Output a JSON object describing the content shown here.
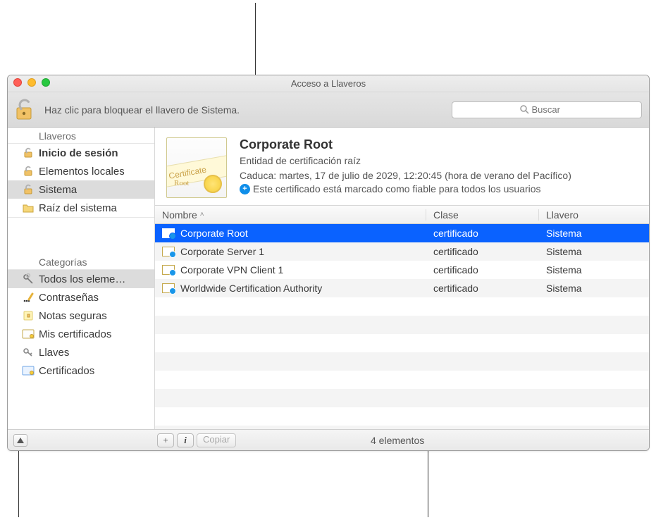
{
  "window": {
    "title": "Acceso a Llaveros"
  },
  "toolbar": {
    "lock_hint": "Haz clic para bloquear el llavero de Sistema.",
    "search_placeholder": "Buscar"
  },
  "sidebar": {
    "keychains_header": "Llaveros",
    "categories_header": "Categorías",
    "keychains": [
      {
        "label": "Inicio de sesión",
        "icon": "unlock",
        "bold": true,
        "selected": false
      },
      {
        "label": "Elementos locales",
        "icon": "unlock",
        "bold": false,
        "selected": false
      },
      {
        "label": "Sistema",
        "icon": "unlock",
        "bold": false,
        "selected": true
      },
      {
        "label": "Raíz del sistema",
        "icon": "folder",
        "bold": false,
        "selected": false
      }
    ],
    "categories": [
      {
        "label": "Todos los eleme…",
        "icon": "keys",
        "selected": true
      },
      {
        "label": "Contraseñas",
        "icon": "pencil",
        "selected": false
      },
      {
        "label": "Notas seguras",
        "icon": "note",
        "selected": false
      },
      {
        "label": "Mis certificados",
        "icon": "cert",
        "selected": false
      },
      {
        "label": "Llaves",
        "icon": "onekey",
        "selected": false
      },
      {
        "label": "Certificados",
        "icon": "certblue",
        "selected": false
      }
    ]
  },
  "detail": {
    "title": "Corporate Root",
    "subtitle": "Entidad de certificación raíz",
    "expires_label": "Caduca:",
    "expires_value": "martes, 17 de julio de 2029, 12:20:45 (hora de verano del Pacífico)",
    "trust_text": "Este certificado está marcado como fiable para todos los usuarios",
    "thumb_text": "Certificate",
    "thumb_root": "Root"
  },
  "table": {
    "columns": {
      "name": "Nombre",
      "class": "Clase",
      "keychain": "Llavero"
    },
    "rows": [
      {
        "name": "Corporate Root",
        "class": "certificado",
        "keychain": "Sistema",
        "selected": true
      },
      {
        "name": "Corporate Server 1",
        "class": "certificado",
        "keychain": "Sistema",
        "selected": false
      },
      {
        "name": "Corporate VPN Client 1",
        "class": "certificado",
        "keychain": "Sistema",
        "selected": false
      },
      {
        "name": "Worldwide Certification Authority",
        "class": "certificado",
        "keychain": "Sistema",
        "selected": false
      }
    ]
  },
  "statusbar": {
    "copy": "Copiar",
    "count": "4 elementos"
  }
}
